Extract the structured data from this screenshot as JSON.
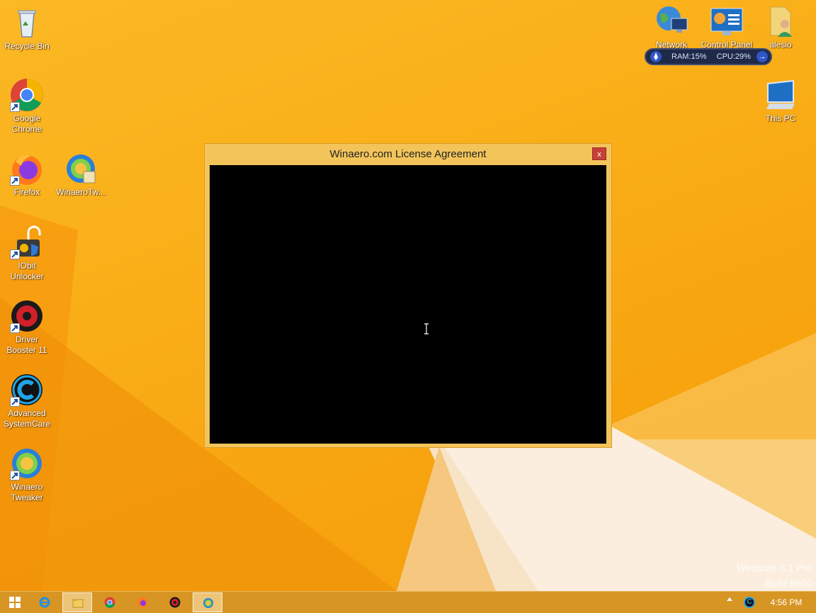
{
  "desktop": {
    "left_icons": [
      {
        "label": "Recycle Bin",
        "icon": "recycle-bin-icon"
      },
      {
        "label": "Google Chrome",
        "icon": "chrome-icon"
      },
      {
        "label": "Firefox",
        "icon": "firefox-icon"
      },
      {
        "label": "WinaeroTw...",
        "icon": "winaero-tweaker-icon"
      },
      {
        "label": "IObit Unlocker",
        "icon": "iobit-unlocker-icon"
      },
      {
        "label": "Driver Booster 11",
        "icon": "driver-booster-icon"
      },
      {
        "label": "Advanced SystemCare",
        "icon": "advanced-systemcare-icon"
      },
      {
        "label": "Winaero Tweaker",
        "icon": "winaero-tweaker-icon"
      }
    ],
    "right_icons": [
      {
        "label": "Network",
        "icon": "network-icon"
      },
      {
        "label": "Control Panel",
        "icon": "control-panel-icon"
      },
      {
        "label": "alesio",
        "icon": "user-folder-icon"
      },
      {
        "label": "This PC",
        "icon": "this-pc-icon"
      }
    ]
  },
  "widget": {
    "ram_label": "RAM:15%",
    "cpu_label": "CPU:29%"
  },
  "license_window": {
    "title": "Winaero.com License Agreement",
    "close_label": "x"
  },
  "watermark": {
    "line1": "Windows 8.1 Pro",
    "line2": "Build 9600"
  },
  "taskbar": {
    "buttons": [
      {
        "icon": "start-icon"
      },
      {
        "icon": "internet-explorer-icon"
      },
      {
        "icon": "file-explorer-icon"
      },
      {
        "icon": "chrome-icon"
      },
      {
        "icon": "firefox-icon"
      },
      {
        "icon": "driver-booster-icon"
      },
      {
        "icon": "winaero-tweaker-icon"
      }
    ],
    "clock": "4:56 PM"
  },
  "colors": {
    "desktop_bg": "#f9ae17",
    "window_frame": "#f3c45a",
    "close_button": "#c7403a",
    "taskbar": "#d79524"
  }
}
